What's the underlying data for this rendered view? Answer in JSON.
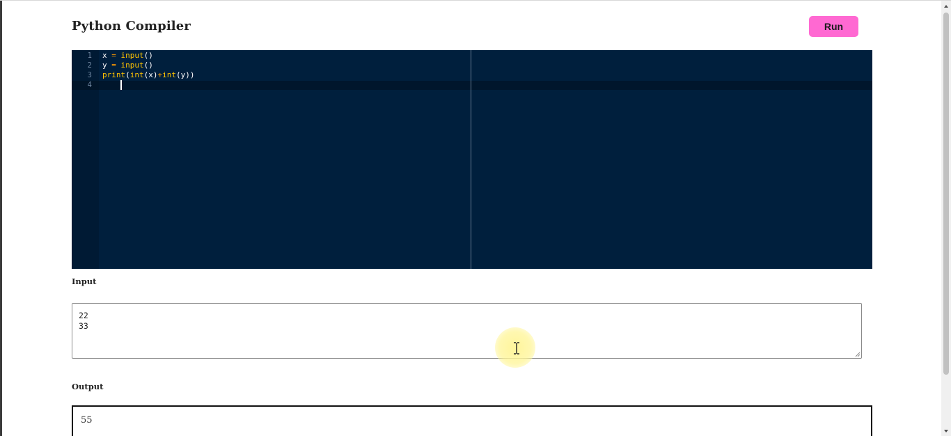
{
  "header": {
    "title": "Python Compiler",
    "run_label": "Run"
  },
  "editor": {
    "line_numbers": [
      "1",
      "2",
      "3",
      "4"
    ],
    "line1": {
      "var": "x",
      "eq": " = ",
      "fn": "input",
      "paren": "()"
    },
    "line2": {
      "var": "y",
      "eq": " = ",
      "fn": "input",
      "paren": "()"
    },
    "line3": {
      "fn1": "print",
      "p1": "(",
      "fn2": "int",
      "p2": "(x)",
      "op": "+",
      "fn3": "int",
      "p3": "(y))"
    }
  },
  "input_section": {
    "label": "Input",
    "value": "22\n33"
  },
  "output_section": {
    "label": "Output",
    "value": "55"
  },
  "colors": {
    "run_button": "#ff69d2",
    "editor_background": "#001f3d",
    "editor_keyword": "#ffc600"
  },
  "icons": {
    "cursor": "ibeam-icon",
    "scroll_up": "chevron-up-icon",
    "scroll_down": "chevron-down-icon"
  }
}
